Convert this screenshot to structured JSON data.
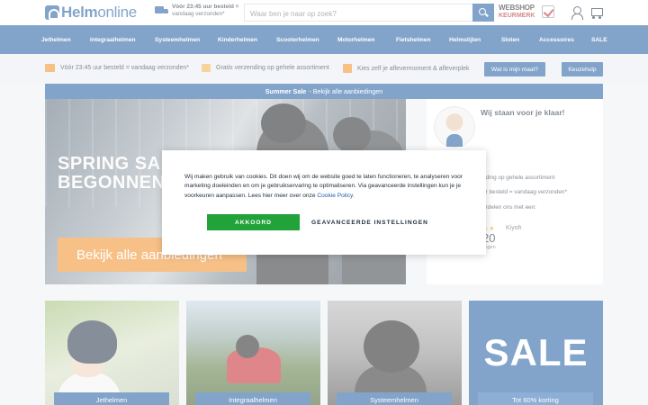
{
  "header": {
    "logo_bold": "Helm",
    "logo_rest": "online",
    "delivery_line1": "Vóór 23:45 uur besteld =",
    "delivery_line2": "vandaag verzonden*",
    "search_placeholder": "Waar ben je naar op zoek?",
    "keurmerk_line1": "WEBSHOP",
    "keurmerk_line2": "KEURMERK"
  },
  "nav": {
    "items": [
      "Jethelmen",
      "Integraalhelmen",
      "Systeemhelmen",
      "Kinderhelmen",
      "Scooterhelmen",
      "Motorhelmen",
      "Fietshelmen",
      "Helmstijlen",
      "Sloten",
      "Accessoires",
      "SALE"
    ]
  },
  "usp": {
    "item1": "Vóór 23:45 uur besteld = vandaag verzonden*",
    "item2": "Gratis verzending op gehele assortiment",
    "item3": "Kies zelf je aflevermoment & afleverplek",
    "btn_size": "Wat is mijn maat?",
    "btn_help": "Keuzehulp"
  },
  "sale_bar": {
    "bold": "Summer Sale",
    "rest": "- Bekijk alle aanbiedingen"
  },
  "hero": {
    "title_line1": "SPRING SAL",
    "title_line2": "BEGONNEN",
    "button": "Bekijk alle aanbiedingen"
  },
  "side": {
    "heading": "Wij staan voor je klaar!",
    "line1": "nding op gehele assortiment",
    "line2": "ur besteld = vandaag verzonden*",
    "line3": "ordelen ons met een:",
    "stars": "★★",
    "kiyoh": "Kiyoh",
    "score": "20",
    "score_sub": "lingen"
  },
  "cards": {
    "c1": "Jethelmen",
    "c2": "Integraalhelmen",
    "c3": "Systeemhelmen",
    "c4_big": "SALE",
    "c4": "Tot 60% korting"
  },
  "cookie": {
    "text": "Wij maken gebruik van cookies. Dit doen wij om de website goed te laten functioneren, te analyseren voor marketing doeleinden en om je gebruikservaring te optimaliseren. Via geavanceerde instellingen kun je je voorkeuren aanpassen. Lees hier meer over onze",
    "link": "Cookie Policy",
    "accept": "AKKOORD",
    "advanced": "GEAVANCEERDE INSTELLINGEN"
  },
  "colors": {
    "brand_blue": "#1e5a9e",
    "accent_orange": "#f08c25",
    "accept_green": "#22a33a"
  }
}
